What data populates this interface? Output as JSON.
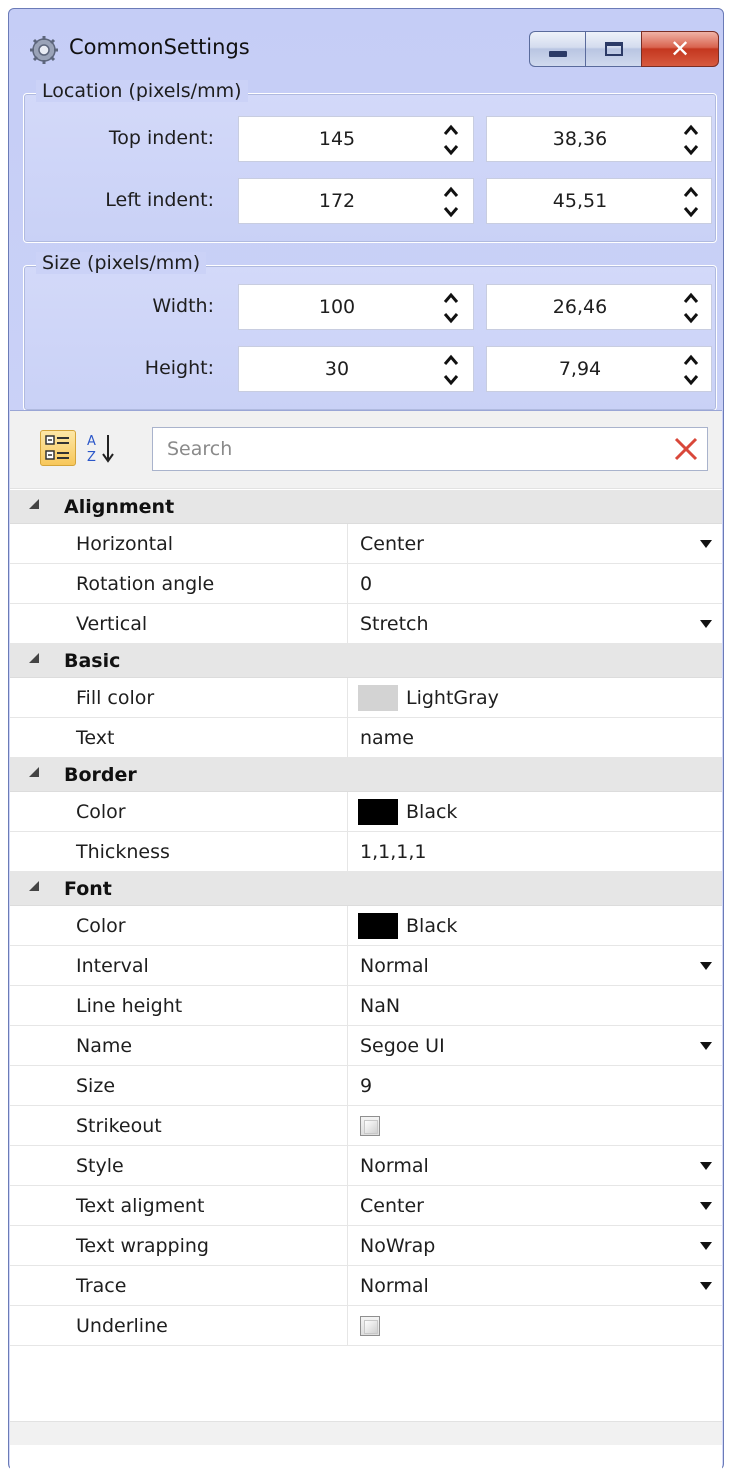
{
  "window": {
    "title": "CommonSettings",
    "icon": "gear-icon",
    "buttons": {
      "minimize": "minimize-icon",
      "maximize": "maximize-icon",
      "close": "close-icon"
    }
  },
  "location": {
    "legend": "Location (pixels/mm)",
    "top": {
      "label": "Top indent:",
      "pixels": "145",
      "mm": "38,36"
    },
    "left": {
      "label": "Left indent:",
      "pixels": "172",
      "mm": "45,51"
    }
  },
  "size": {
    "legend": "Size (pixels/mm)",
    "width": {
      "label": "Width:",
      "pixels": "100",
      "mm": "26,46"
    },
    "height": {
      "label": "Height:",
      "pixels": "30",
      "mm": "7,94"
    }
  },
  "toolbar": {
    "categorized_icon": "categorized-view-icon",
    "sort_icon": "sort-alphabetical-icon",
    "search_placeholder": "Search",
    "clear_icon": "clear-search-icon"
  },
  "colors": {
    "accent": "#c5cdf6",
    "close": "#c4371f",
    "category_bg": "#e6e6e6",
    "fill_lightgray": "#d3d3d3",
    "black": "#000000"
  },
  "categories": {
    "alignment": {
      "name": "Alignment",
      "horizontal": {
        "name": "Horizontal",
        "value": "Center"
      },
      "rotation": {
        "name": "Rotation angle",
        "value": "0"
      },
      "vertical": {
        "name": "Vertical",
        "value": "Stretch"
      }
    },
    "basic": {
      "name": "Basic",
      "fill": {
        "name": "Fill color",
        "value": "LightGray"
      },
      "text": {
        "name": "Text",
        "value": "name"
      }
    },
    "border": {
      "name": "Border",
      "color": {
        "name": "Color",
        "value": "Black"
      },
      "thickness": {
        "name": "Thickness",
        "value": "1,1,1,1"
      }
    },
    "font": {
      "name": "Font",
      "color": {
        "name": "Color",
        "value": "Black"
      },
      "interval": {
        "name": "Interval",
        "value": "Normal"
      },
      "line_height": {
        "name": "Line height",
        "value": "NaN"
      },
      "fname": {
        "name": "Name",
        "value": "Segoe UI"
      },
      "size": {
        "name": "Size",
        "value": "9"
      },
      "strikeout": {
        "name": "Strikeout",
        "checked": false
      },
      "style": {
        "name": "Style",
        "value": "Normal"
      },
      "text_alignment": {
        "name": "Text aligment",
        "value": "Center"
      },
      "text_wrapping": {
        "name": "Text wrapping",
        "value": "NoWrap"
      },
      "trace": {
        "name": "Trace",
        "value": "Normal"
      },
      "underline": {
        "name": "Underline",
        "checked": false
      }
    }
  }
}
